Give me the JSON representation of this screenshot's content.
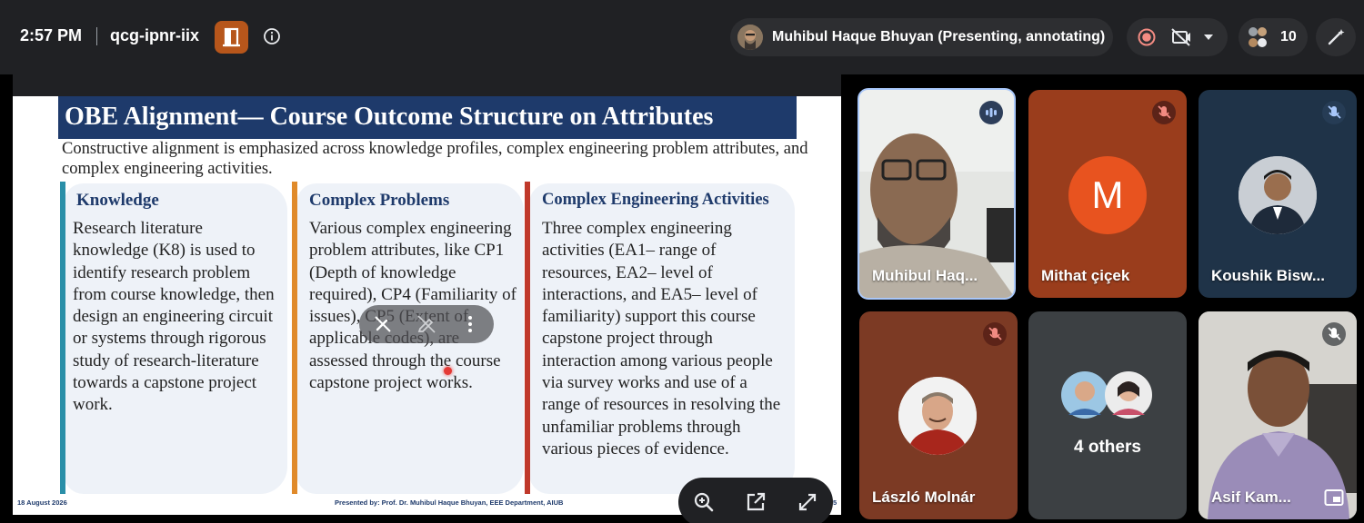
{
  "topbar": {
    "time": "2:57 PM",
    "meeting_code": "qcg-ipnr-iix",
    "presenter_label": "Muhibul Haque Bhuyan (Presenting, annotating)",
    "participant_count": "10"
  },
  "slide": {
    "title": "OBE Alignment— Course Outcome Structure on Attributes",
    "subtitle": "Constructive alignment is emphasized across knowledge profiles, complex engineering problem attributes, and complex engineering activities.",
    "columns": [
      {
        "heading": "Knowledge",
        "text": "Research literature knowledge (K8) is used to identify research problem from course knowledge, then design an engineering circuit or systems through rigorous study of research-literature towards a capstone project work.",
        "accent": "#2a8fa8"
      },
      {
        "heading": "Complex Problems",
        "text": "Various complex engineering problem attributes, like CP1 (Depth of knowledge required), CP4 (Familiarity of issues), CP5 (Extent of applicable codes), are assessed through the course capstone project works.",
        "accent": "#e08a2a"
      },
      {
        "heading": "Complex Engineering Activities",
        "text": "Three complex engineering activities (EA1– range of resources, EA2– level of interactions, and EA5– level of familiarity) support this course capstone project through interaction among various people via survey works and use of a range of resources in resolving the unfamiliar problems through various pieces of evidence.",
        "accent": "#c0392b"
      }
    ],
    "footer_date": "18 August 2026",
    "footer_presenter": "Presented by: Prof. Dr. Muhibul Haque Bhuyan, EEE Department, AIUB",
    "footer_page": "5"
  },
  "participants": [
    {
      "name": "Muhibul Haq...",
      "state": "speaking"
    },
    {
      "name": "Mithat çiçek",
      "initial": "M",
      "state": "muted"
    },
    {
      "name": "Koushik Bisw...",
      "state": "muted"
    },
    {
      "name": "László Molnár",
      "state": "muted"
    },
    {
      "name": "4 others"
    },
    {
      "name": "Asif Kam...",
      "state": "muted"
    }
  ],
  "colors": {
    "topbar_bg": "#202124",
    "slide_title_bg": "#1e3a6b",
    "mute_badge": "#5c2318",
    "speaking_badge": "#2d3e5a",
    "avatar_orange": "#e8531f"
  },
  "icons": [
    "door-icon",
    "info-icon",
    "record-icon",
    "camera-off-icon",
    "chevron-down-icon",
    "people-icon",
    "magic-pen-icon",
    "mic-off-icon",
    "zoom-in-icon",
    "pop-out-icon",
    "fullscreen-icon",
    "pen-off-icon",
    "annotate-icon",
    "more-vert-icon",
    "pin-icon"
  ]
}
